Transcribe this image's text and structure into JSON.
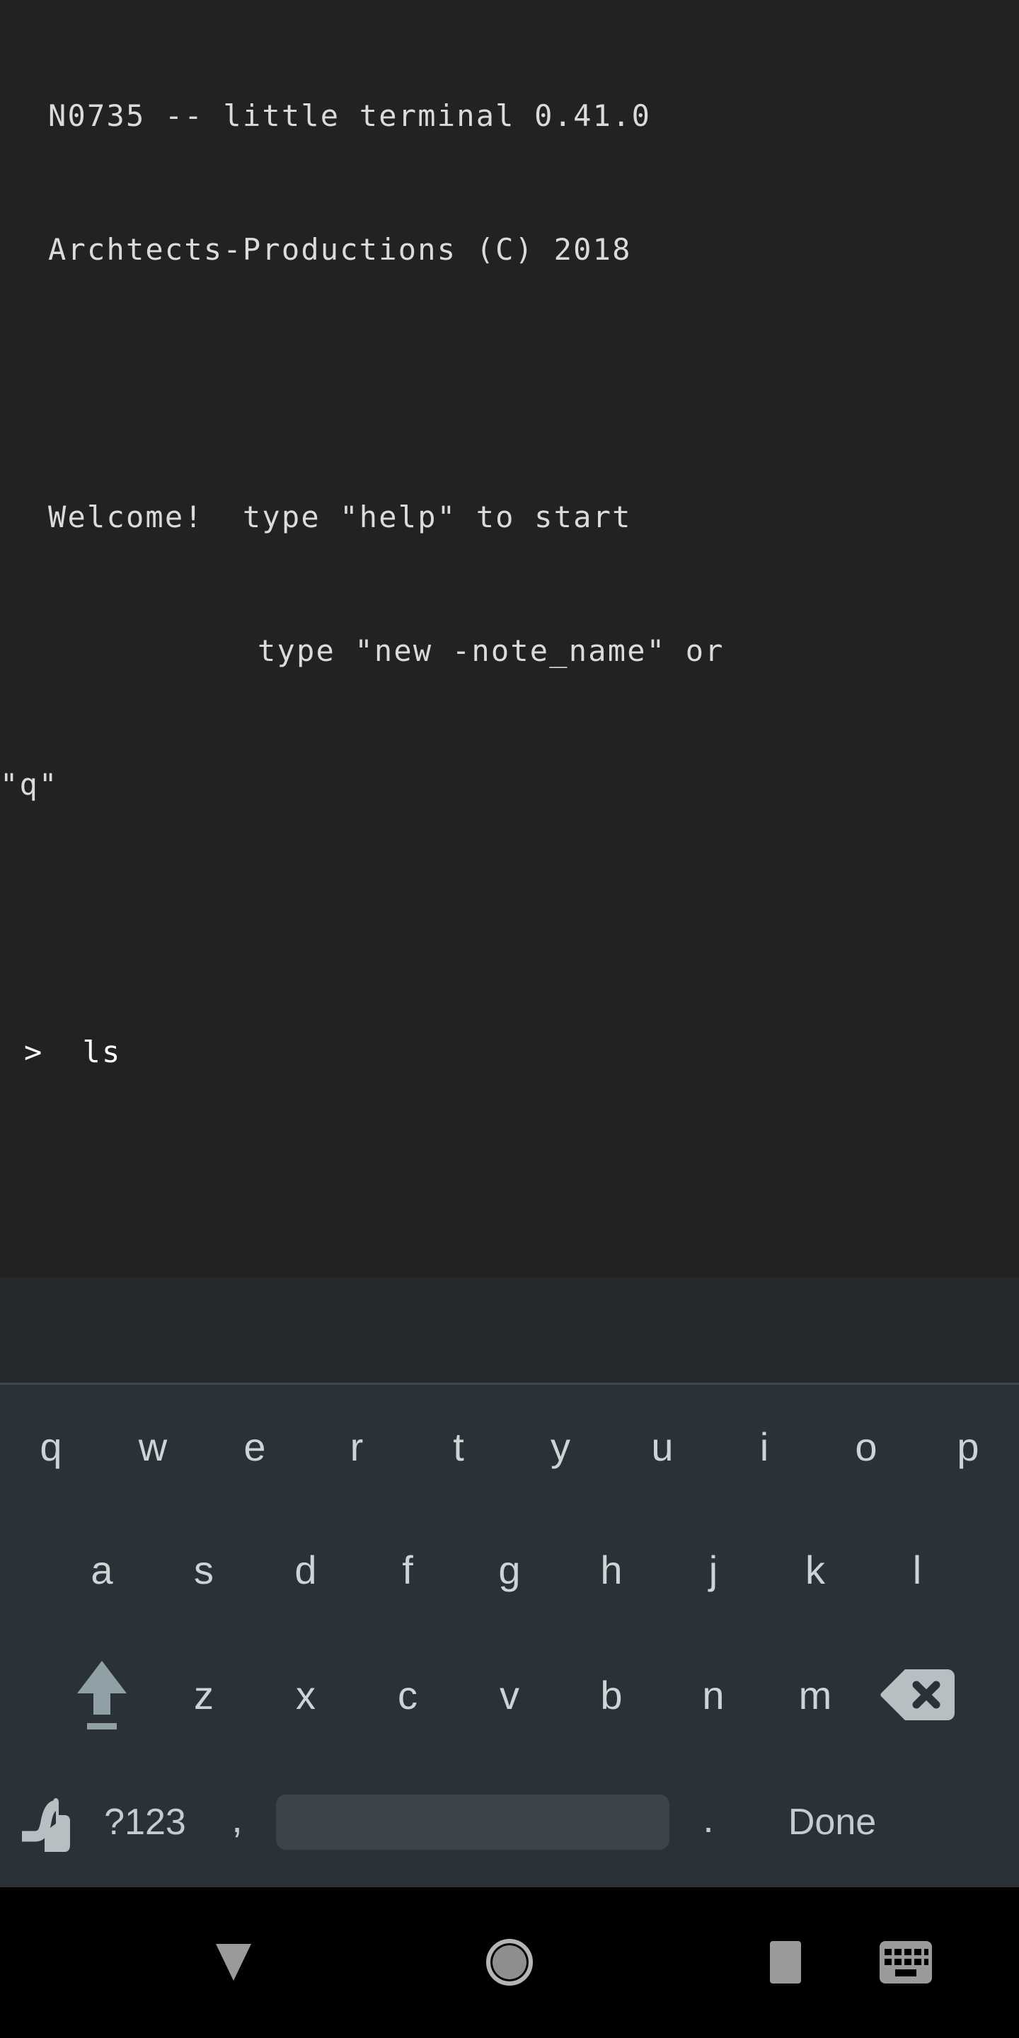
{
  "app": {
    "name": "little terminal",
    "colors": {
      "terminal_bg": "#222222",
      "terminal_fg": "#d9dcd9",
      "prompt_fg": "#ffffff",
      "keyboard_bg": "#2a3238",
      "key_fg": "#ccd4d6",
      "spacebar_bg": "#3b4549",
      "gap_bg": "#242a2e",
      "navbar_bg": "#000000",
      "nav_icon": "#9a9a9a"
    }
  },
  "terminal": {
    "lines": [
      "N0735 -- little terminal 0.41.0",
      "Archtects-Productions (C) 2018"
    ],
    "blank_after_header": "",
    "welcome": {
      "line1": "Welcome!  type \"help\" to start",
      "line2": "type \"new -note_name\" or \"q\"",
      "line2_indent_part": "type \"new -note_name\" or",
      "line2_wrap_part": "\"q\""
    },
    "prompt": {
      "symbol": ">",
      "command": "ls",
      "full": ">  ls"
    }
  },
  "keyboard": {
    "layout": "qwerty",
    "language": "en",
    "rows": {
      "row1": [
        "q",
        "w",
        "e",
        "r",
        "t",
        "y",
        "u",
        "i",
        "o",
        "p"
      ],
      "row2": [
        "a",
        "s",
        "d",
        "f",
        "g",
        "h",
        "j",
        "k",
        "l"
      ],
      "row3_letters": [
        "z",
        "x",
        "c",
        "v",
        "b",
        "n",
        "m"
      ],
      "row3_shift_icon": "shift-arrow-icon",
      "row3_backspace_icon": "backspace-icon"
    },
    "row4": {
      "ime_icon": "handwriting-gesture-icon",
      "symbols_label": "?123",
      "comma_label": ",",
      "space_label": "",
      "period_label": ".",
      "action_label": "Done"
    }
  },
  "navbar": {
    "back_icon": "back-triangle-icon",
    "home_icon": "home-circle-icon",
    "recents_icon": "recents-square-icon",
    "keyboard_switch_icon": "keyboard-icon"
  }
}
